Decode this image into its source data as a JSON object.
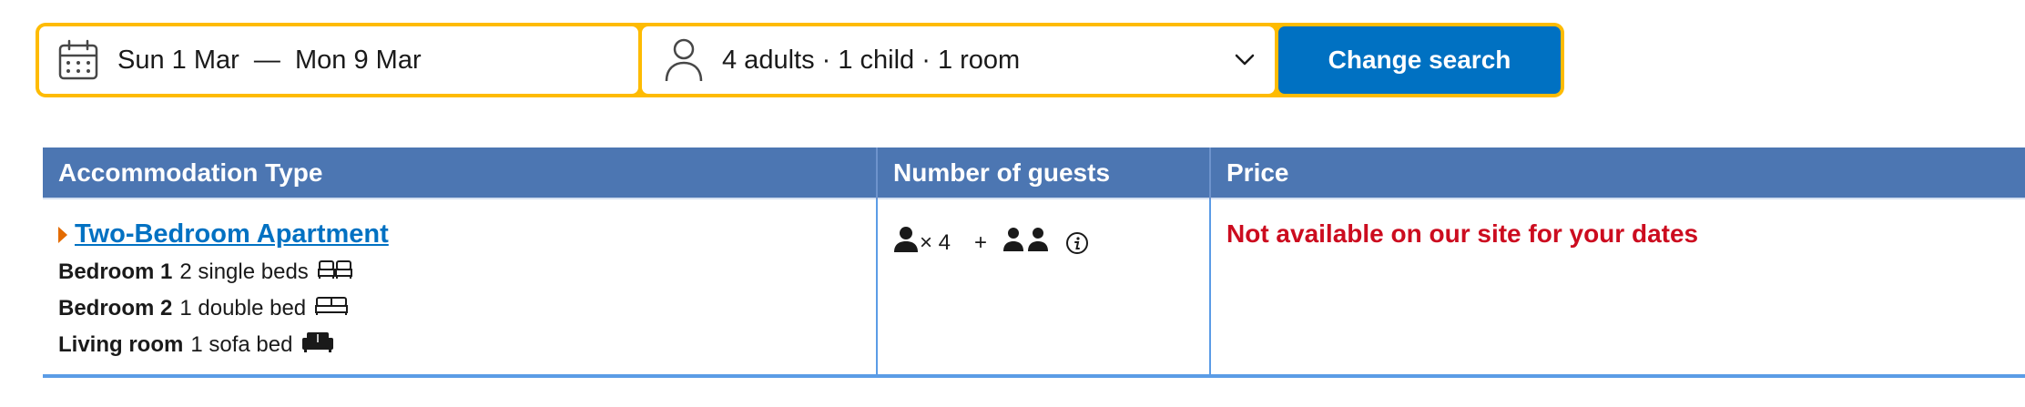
{
  "search": {
    "dates_text": "Sun 1 Mar  —  Mon 9 Mar",
    "guests_text": "4 adults · 1 child · 1 room",
    "button_label": "Change search"
  },
  "table": {
    "headers": [
      "Accommodation Type",
      "Number of guests",
      "Price"
    ],
    "row": {
      "title": "Two-Bedroom Apartment",
      "beds": [
        {
          "room": "Bedroom 1",
          "detail": "2 single beds"
        },
        {
          "room": "Bedroom 2",
          "detail": "1 double bed"
        },
        {
          "room": "Living room",
          "detail": "1 sofa bed"
        }
      ],
      "guests": {
        "adult_multiplier": "× 4",
        "plus": "+"
      },
      "price_text": "Not available on our site for your dates"
    }
  },
  "colors": {
    "accent_yellow": "#febb02",
    "primary_blue": "#0071c2",
    "header_blue": "#4c76b2",
    "error_red": "#cc0c1f"
  },
  "icons": [
    "calendar-icon",
    "person-icon",
    "chevron-down-icon",
    "single-beds-icon",
    "double-bed-icon",
    "sofa-bed-icon",
    "adult-icon",
    "children-icon",
    "info-icon"
  ]
}
